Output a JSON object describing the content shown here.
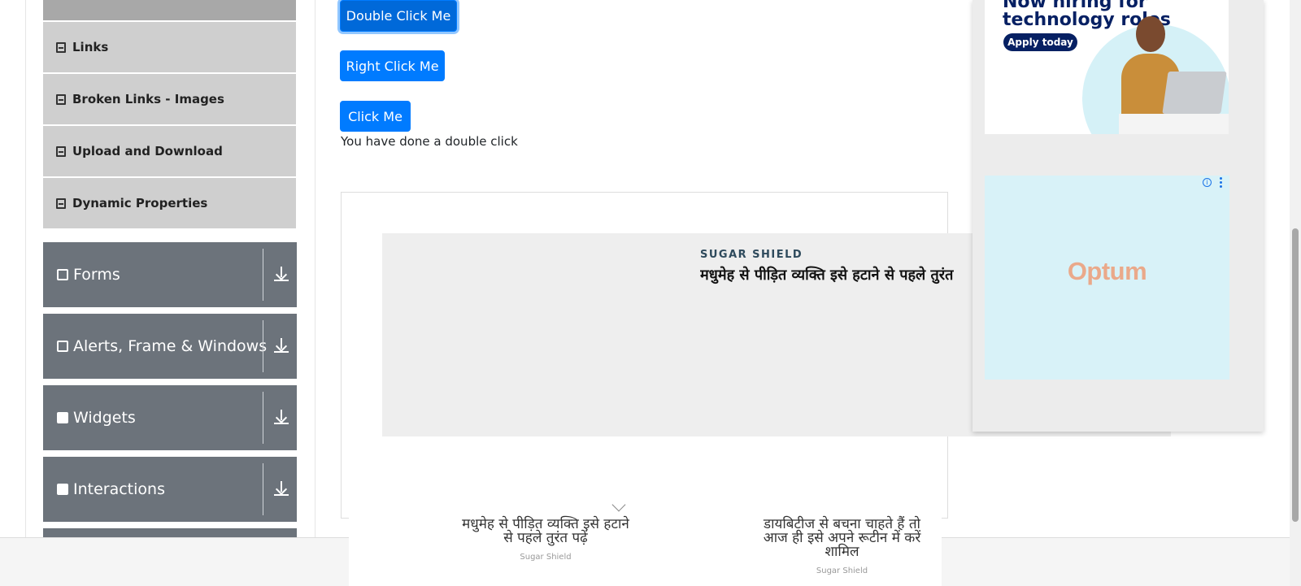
{
  "sidebar": {
    "elements_items": [
      {
        "label": ""
      },
      {
        "label": "Links"
      },
      {
        "label": "Broken Links - Images"
      },
      {
        "label": "Upload and Download"
      },
      {
        "label": "Dynamic Properties"
      }
    ],
    "groups": [
      {
        "label": "Forms",
        "icon": "form-icon"
      },
      {
        "label": "Alerts, Frame & Windows",
        "icon": "window-icon"
      },
      {
        "label": "Widgets",
        "icon": "widgets-icon"
      },
      {
        "label": "Interactions",
        "icon": "interactions-icon"
      }
    ]
  },
  "buttons": {
    "double_click": "Double Click Me",
    "right_click": "Right Click Me",
    "click": "Click Me"
  },
  "message": "You have done a double click",
  "ad_main": {
    "brand": "SUGAR SHIELD",
    "headline": "मधुमेह से पीड़ित व्यक्ति इसे हटाने से पहले तुरंत"
  },
  "bottom_stories": [
    {
      "title": "मधुमेह से पीड़ित व्यक्ति इसे हटाने से पहले तुरंत पढ़ें",
      "source": "Sugar Shield"
    },
    {
      "title": "डायबिटीज से बचना चाहते हैं तो आज ही इसे अपने रूटीन में करें शामिल",
      "source": "Sugar Shield"
    }
  ],
  "side_ad_1": {
    "line1": "Now hiring for",
    "line2": "technology roles",
    "cta": "Apply today"
  },
  "side_ad_2": {
    "logo": "Optum",
    "info": "i"
  },
  "colors": {
    "primary": "#007bff",
    "sidebar_group": "#6c737b",
    "sidebar_item": "#cfcfcf",
    "optum": "#eaa98a"
  }
}
